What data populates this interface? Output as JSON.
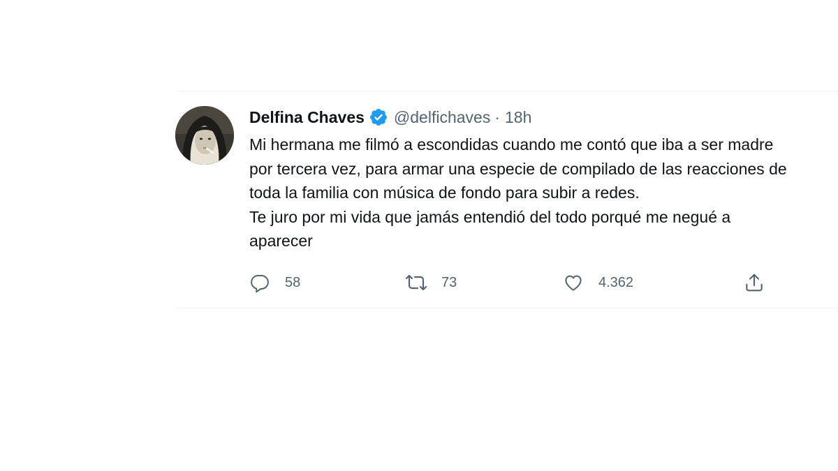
{
  "tweet": {
    "display_name": "Delfina Chaves",
    "handle": "@delfichaves",
    "separator": "·",
    "time": "18h",
    "lines": [
      "Mi hermana me filmó a escondidas cuando me contó que iba a ser madre",
      "por tercera vez, para armar una especie de compilado de las reacciones de",
      "toda la familia con música de fondo para subir a redes.",
      "Te juro por mi vida que jamás entendió del todo porqué me negué a",
      "aparecer"
    ]
  },
  "actions": {
    "replies": "58",
    "retweets": "73",
    "likes": "4.362"
  },
  "icons": {
    "verified": "verified-badge-icon",
    "reply": "reply-icon",
    "retweet": "retweet-icon",
    "like": "heart-icon",
    "share": "share-icon"
  },
  "colors": {
    "text": "#0f1419",
    "secondary": "#536471",
    "verified": "#1d9bf0",
    "divider": "#eff3f4"
  }
}
